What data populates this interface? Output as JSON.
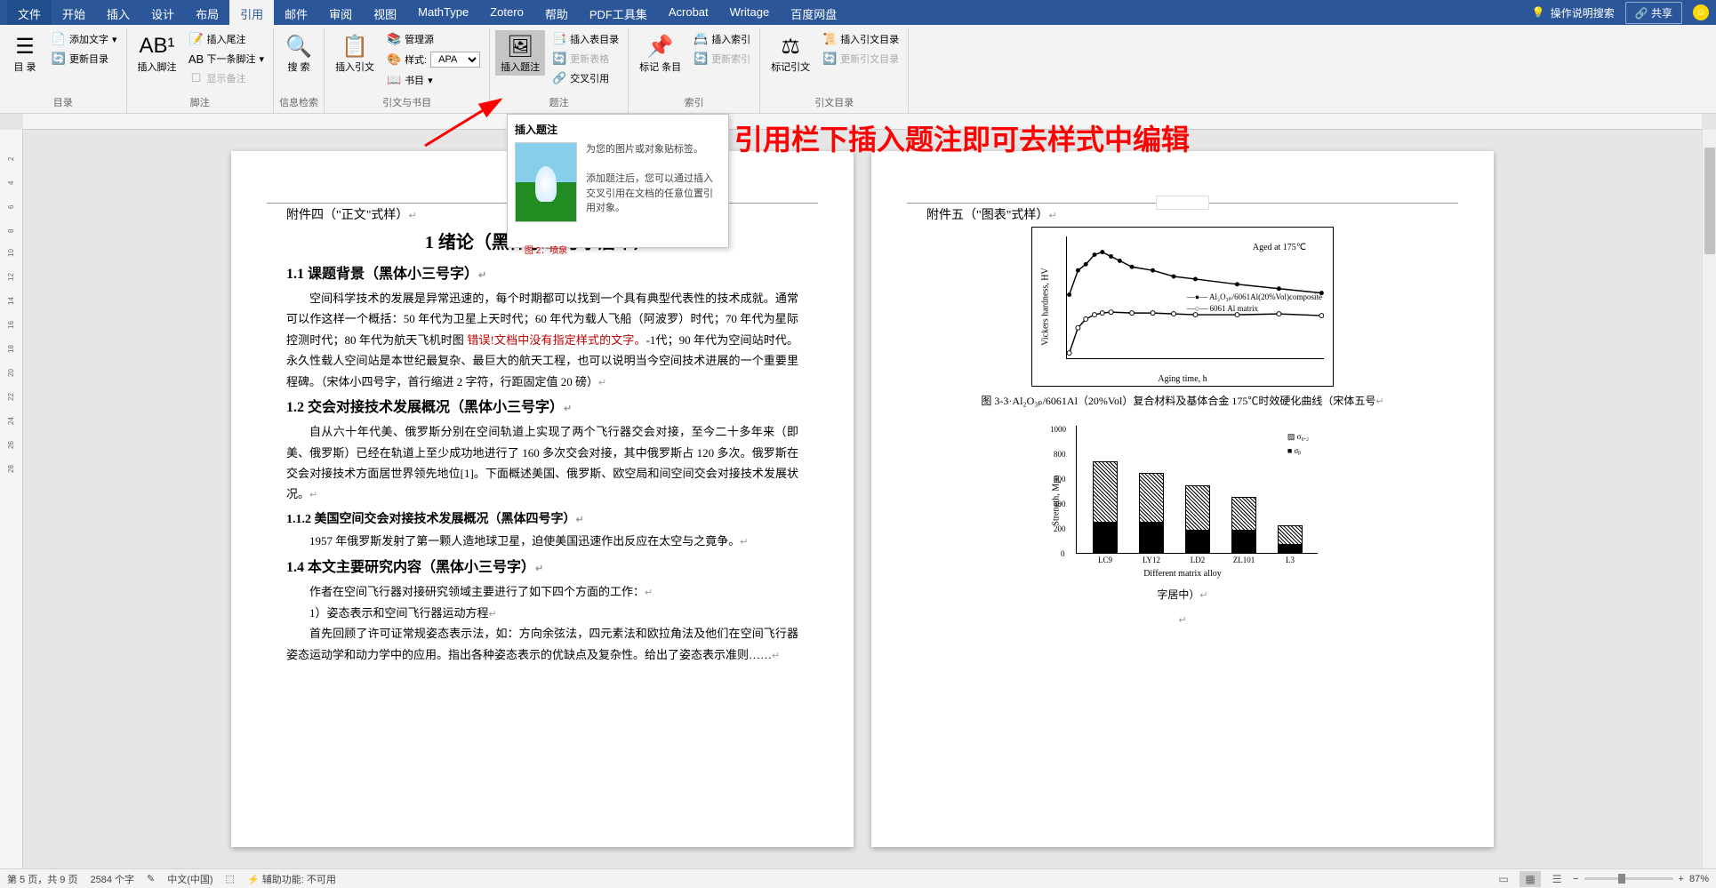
{
  "menu": {
    "file": "文件",
    "tabs": [
      "开始",
      "插入",
      "设计",
      "布局",
      "引用",
      "邮件",
      "审阅",
      "视图",
      "MathType",
      "Zotero",
      "帮助",
      "PDF工具集",
      "Acrobat",
      "Writage",
      "百度网盘"
    ],
    "active_index": 4,
    "search_hint": "操作说明搜索",
    "share": "共享"
  },
  "ribbon": {
    "g1": {
      "label": "目录",
      "toc": "目\n录",
      "add_text": "添加文字",
      "update_toc": "更新目录"
    },
    "g2": {
      "label": "脚注",
      "insert_fn": "插入脚注",
      "insert_en": "插入尾注",
      "next_fn": "下一条脚注",
      "show_notes": "显示备注"
    },
    "g3": {
      "label": "信息检索",
      "search": "搜\n索"
    },
    "g4": {
      "label": "引文与书目",
      "insert_cite": "插入引文",
      "manage": "管理源",
      "style_label": "样式:",
      "style_value": "APA",
      "bib": "书目"
    },
    "g5": {
      "label": "题注",
      "insert_caption": "插入题注",
      "insert_fig_toc": "插入表目录",
      "update_fig": "更新表格",
      "cross_ref": "交叉引用"
    },
    "g6": {
      "label": "索引",
      "mark_entry": "标记\n条目",
      "insert_idx": "插入索引",
      "update_idx": "更新索引"
    },
    "g7": {
      "label": "引文目录",
      "mark_cite": "标记引文",
      "insert_auth": "插入引文目录",
      "update_auth": "更新引文目录"
    }
  },
  "tooltip": {
    "title": "插入题注",
    "line1": "为您的图片或对象贴标签。",
    "line2": "添加题注后，您可以通过插入交叉引用在文档的任意位置引用对象。",
    "img_caption": "图 2：喷泉"
  },
  "annotation": "引用栏下插入题注即可去样式中编辑",
  "page1": {
    "attach": "附件四（\"正文\"式样）",
    "h1": "1 绪论（黑体小二号字居中）",
    "h2_1": "1.1 课题背景（黑体小三号字）",
    "p1a": "空间科学技术的发展是异常迅速的，每个时期都可以找到一个具有典型代表性的技术成就。通常可以作这样一个概括：50 年代为卫星上天时代；60 年代为载人飞船（阿波罗）时代；70 年代为星际控测时代；80 年代为航天飞机时图 ",
    "p1_err": "错误!文档中没有指定样式的文字。",
    "p1b": "-1代；90 年代为空间站时代。永久性载人空间站是本世纪最复杂、最巨大的航天工程，也可以说明当今空间技术进展的一个重要里程碑。（宋体小四号字，首行缩进 2 字符，行距固定值 20 磅）",
    "h2_2": "1.2 交会对接技术发展概况（黑体小三号字）",
    "p2": "自从六十年代美、俄罗斯分别在空间轨道上实现了两个飞行器交会对接，至今二十多年来（即美、俄罗斯）已经在轨道上至少成功地进行了 160 多次交会对接，其中俄罗斯占 120 多次。俄罗斯在交会对接技术方面居世界领先地位[1]。下面概述美国、俄罗斯、欧空局和间空间交会对接技术发展状况。",
    "h3_1": "1.1.2 美国空间交会对接技术发展概况（黑体四号字）",
    "p3": "1957 年俄罗斯发射了第一颗人造地球卫星，迫使美国迅速作出反应在太空与之竟争。",
    "h2_3": "1.4 本文主要研究内容（黑体小三号字）",
    "p4": "作者在空间飞行器对接研究领域主要进行了如下四个方面的工作：",
    "p5": "1）姿态表示和空间飞行器运动方程",
    "p6": "首先回顾了许可证常规姿态表示法，如：方向余弦法，四元素法和欧拉角法及他们在空间飞行器姿态运动学和动力学中的应用。指出各种姿态表示的优缺点及复杂性。给出了姿态表示准则……"
  },
  "page2": {
    "attach": "附件五（\"图表\"式样）",
    "caption1": "图 3-3·Al₂O₃ₚ/6061Al（20%Vol）复合材料及基体合金 175℃时效硬化曲线（宋体五号",
    "caption2": "字居中）"
  },
  "chart_data": [
    {
      "type": "line",
      "title": "",
      "xlabel": "Aging time, h",
      "ylabel": "Vickers hardness, HV",
      "xlim": [
        0,
        60
      ],
      "ylim": [
        50,
        250
      ],
      "xticks": [
        0,
        10,
        20,
        30,
        40,
        50,
        60
      ],
      "yticks": [
        50,
        100,
        150,
        200,
        250
      ],
      "annotation": "Aged at 175℃",
      "series": [
        {
          "name": "Al₂O₃ₚ/6061Al(20%Vol)composite",
          "marker": "filled",
          "x": [
            0,
            2,
            4,
            6,
            8,
            10,
            12,
            15,
            20,
            25,
            30,
            40,
            50,
            60
          ],
          "y": [
            155,
            195,
            205,
            220,
            225,
            218,
            210,
            200,
            195,
            185,
            180,
            172,
            165,
            158
          ]
        },
        {
          "name": "6061 Al matrix",
          "marker": "open",
          "x": [
            0,
            2,
            4,
            6,
            8,
            10,
            15,
            20,
            25,
            30,
            40,
            50,
            60
          ],
          "y": [
            58,
            100,
            115,
            122,
            125,
            126,
            125,
            124,
            123,
            122,
            122,
            123,
            120
          ]
        }
      ]
    },
    {
      "type": "bar",
      "xlabel": "Different matrix alloy",
      "ylabel": "Strength, Mpa",
      "ylim": [
        0,
        1000
      ],
      "yticks": [
        0,
        200,
        400,
        600,
        800,
        1000
      ],
      "categories": [
        "LC9",
        "LY12",
        "LD2",
        "ZL101",
        "L3"
      ],
      "legend": [
        "σ₀.₂",
        "σᵦ"
      ],
      "series": [
        {
          "name": "σ_top",
          "values": [
            730,
            640,
            540,
            450,
            220
          ]
        },
        {
          "name": "σ_bot",
          "values": [
            240,
            240,
            180,
            180,
            60
          ]
        }
      ]
    }
  ],
  "status": {
    "page": "第 5 页，共 9 页",
    "words": "2584 个字",
    "spell_icon": "✎",
    "lang": "中文(中国)",
    "track": "⬚",
    "accessibility": "辅助功能: 不可用",
    "zoom": "87%"
  }
}
